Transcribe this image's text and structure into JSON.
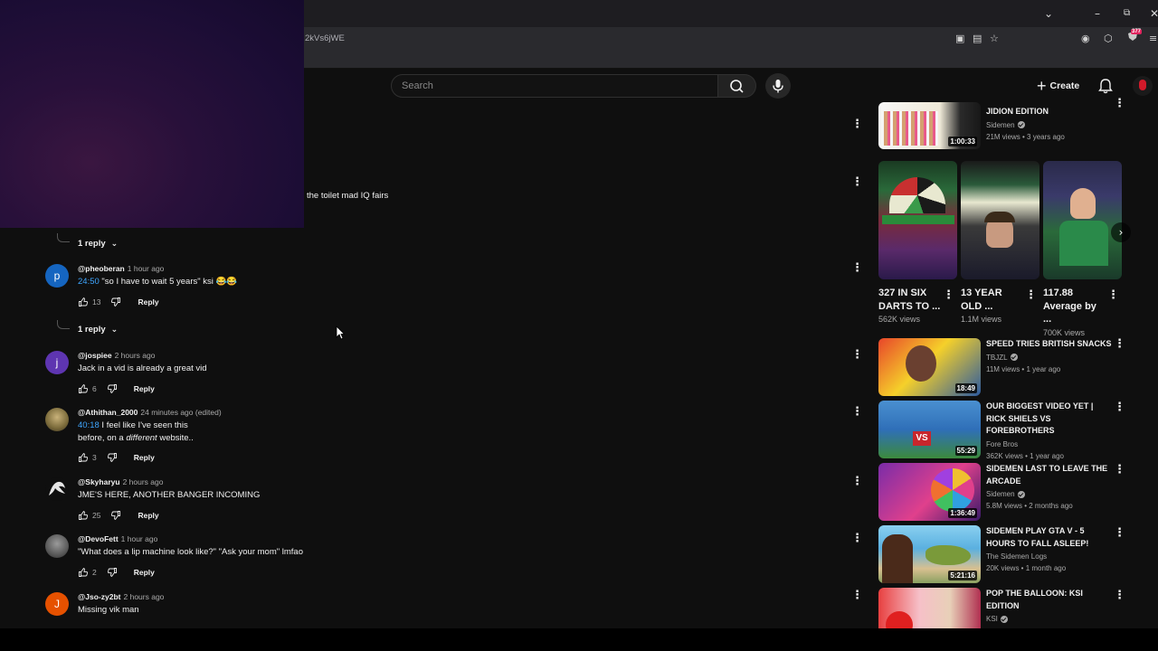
{
  "browser": {
    "url_fragment": "2kVs6jWE",
    "extension_badge": "377"
  },
  "header": {
    "search_placeholder": "Search",
    "create_label": "Create"
  },
  "comments": {
    "truncated_text": "the toilet mad IQ fairs",
    "top_reply_toggle": "1 reply",
    "reply_label": "Reply",
    "items": [
      {
        "avatar": "p",
        "avatar_color": "#1565c0",
        "handle": "@pheoberan",
        "time": "1 hour ago",
        "timestamp": "24:50",
        "text": "\"so I have to wait 5 years\" ksi 😂😂",
        "likes": "13",
        "reply_toggle": "1 reply"
      },
      {
        "avatar": "j",
        "avatar_color": "#5e35b1",
        "handle": "@jospiee",
        "time": "2 hours ago",
        "text": "Jack in a vid is already a great vid",
        "likes": "6"
      },
      {
        "avatar": "",
        "avatar_color": "#7a6a3a",
        "handle": "@Athithan_2000",
        "time": "24 minutes ago (edited)",
        "timestamp": "40:18",
        "text_line1": "I feel like I've seen this",
        "text_line2_pre": "before, on a ",
        "text_line2_em": "different",
        "text_line2_post": " website..",
        "likes": "3"
      },
      {
        "avatar": "",
        "avatar_color": "#d0d0d0",
        "handle": "@Skyharyu",
        "time": "2 hours ago",
        "text": "JME'S HERE, ANOTHER BANGER INCOMING",
        "likes": "25"
      },
      {
        "avatar": "",
        "avatar_color": "#6b6b6b",
        "handle": "@DevoFett",
        "time": "1 hour ago",
        "text": "\"What does a lip machine look like?\" \"Ask your mom\" lmfao",
        "likes": "2"
      },
      {
        "avatar": "J",
        "avatar_color": "#e65100",
        "handle": "@Jso-zy2bt",
        "time": "2 hours ago",
        "text": "Missing vik man"
      }
    ]
  },
  "sidebar": {
    "top_video": {
      "title": "JIDION EDITION",
      "channel": "Sidemen",
      "stats": "21M views • 3 years ago",
      "duration": "1:00:33"
    },
    "shorts": [
      {
        "title": "327 IN SIX DARTS TO ...",
        "views": "562K views"
      },
      {
        "title": "13 YEAR OLD ...",
        "views": "1.1M views"
      },
      {
        "title": "117.88 Average by ...",
        "views": "700K views"
      }
    ],
    "videos": [
      {
        "title": "SPEED TRIES BRITISH SNACKS",
        "channel": "TBJZL",
        "verified": true,
        "stats": "11M views • 1 year ago",
        "duration": "18:49",
        "colors": [
          "#e8452a",
          "#f5d02a",
          "#2c5aa0"
        ]
      },
      {
        "title": "OUR BIGGEST VIDEO YET | RICK SHIELS VS FOREBROTHERS",
        "channel": "Fore Bros",
        "verified": false,
        "stats": "362K views • 1 year ago",
        "duration": "55:29",
        "colors": [
          "#2f6fb8",
          "#3c8a3c",
          "#c8262c"
        ]
      },
      {
        "title": "SIDEMEN LAST TO LEAVE THE ARCADE",
        "channel": "Sidemen",
        "verified": true,
        "stats": "5.8M views • 2 months ago",
        "duration": "1:36:49",
        "colors": [
          "#7a2ca8",
          "#e0408c",
          "#f0c030"
        ]
      },
      {
        "title": "SIDEMEN PLAY GTA V - 5 HOURS TO FALL ASLEEP!",
        "channel": "The Sidemen Logs",
        "verified": false,
        "stats": "20K views • 1 month ago",
        "duration": "5:21:16",
        "colors": [
          "#5ab0e0",
          "#8aa060",
          "#d8c090"
        ]
      },
      {
        "title": "POP THE BALLOON: KSI EDITION",
        "channel": "KSI",
        "verified": true,
        "stats": "",
        "duration": "",
        "colors": [
          "#f03030",
          "#f6c0c8",
          "#b03050"
        ]
      }
    ]
  }
}
